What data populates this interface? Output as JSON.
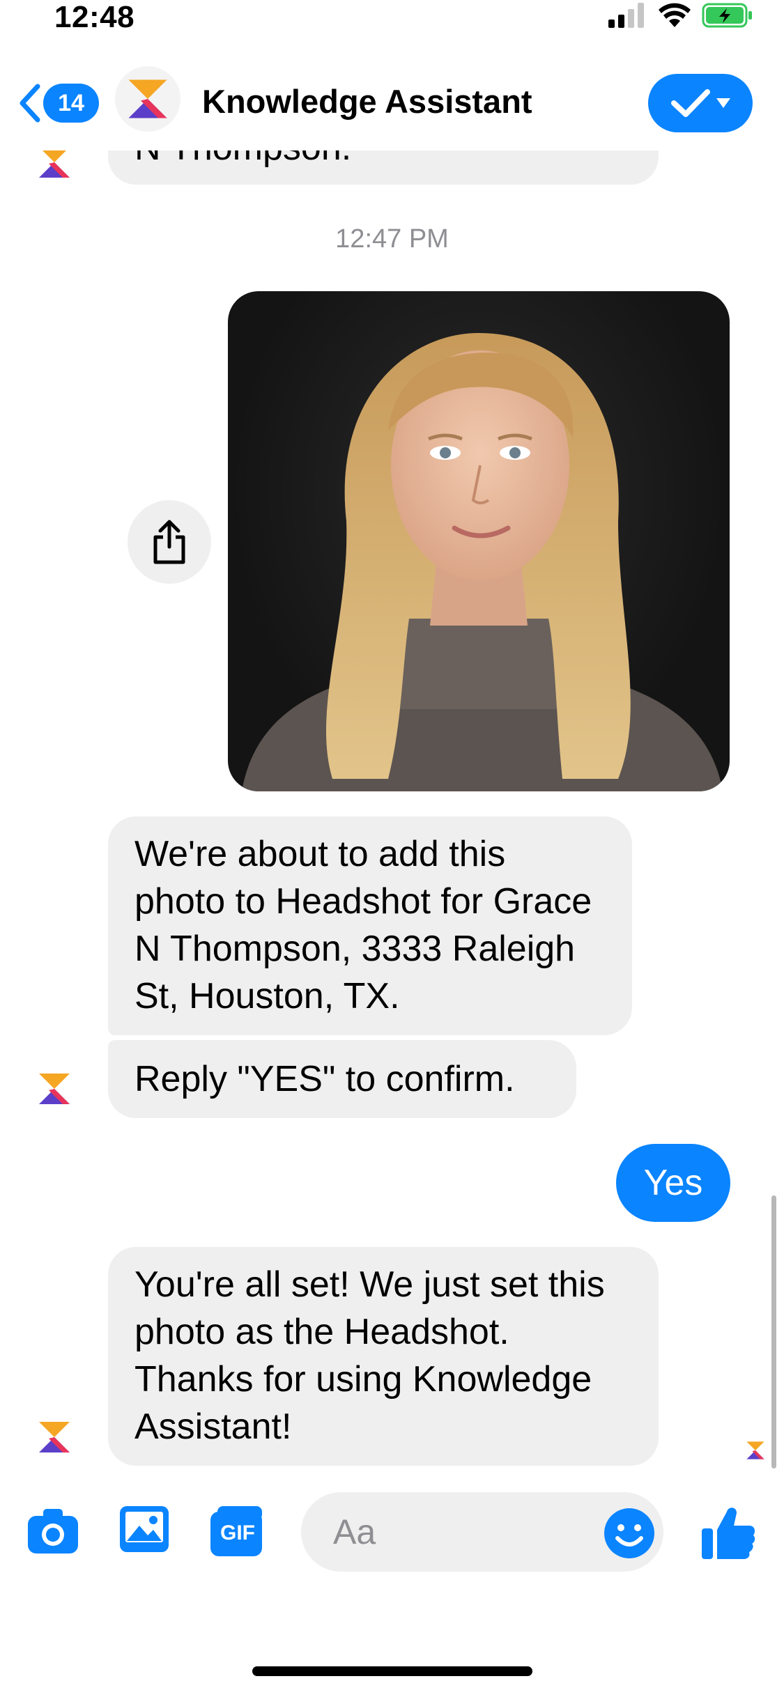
{
  "status_bar": {
    "time": "12:48"
  },
  "header": {
    "back_badge": "14",
    "title": "Knowledge Assistant"
  },
  "conversation": {
    "partial_previous_message": "N Thompson.",
    "timestamp": "12:47 PM",
    "confirm_message": "We're about to add this photo to Headshot for Grace N Thompson, 3333 Raleigh St, Houston, TX.",
    "confirm_prompt": "Reply \"YES\" to confirm.",
    "user_reply": "Yes",
    "final_message": "You're all set! We just set this photo as the Headshot. Thanks for using Knowledge Assistant!"
  },
  "composer": {
    "placeholder": "Aa",
    "gif_label": "GIF"
  },
  "colors": {
    "accent": "#0a84ff",
    "incoming_bubble": "#efefef",
    "timestamp_text": "#8e8e93"
  }
}
